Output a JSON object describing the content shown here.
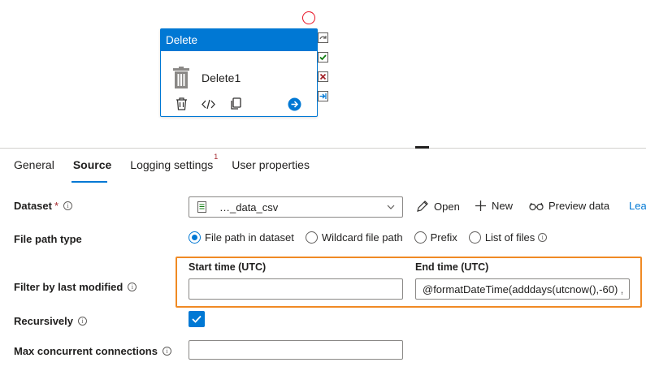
{
  "activity": {
    "header": "Delete",
    "name": "Delete1"
  },
  "tabs": [
    {
      "label": "General"
    },
    {
      "label": "Source"
    },
    {
      "label": "Logging settings",
      "badge": "1"
    },
    {
      "label": "User properties"
    }
  ],
  "form": {
    "dataset": {
      "label": "Dataset",
      "required": "*",
      "value": "…_data_csv",
      "actions": {
        "open": "Open",
        "new": "New",
        "preview": "Preview data",
        "learn": "Lea"
      }
    },
    "file_path_type": {
      "label": "File path type",
      "options": [
        "File path in dataset",
        "Wildcard file path",
        "Prefix",
        "List of files"
      ],
      "selected": "File path in dataset"
    },
    "filter": {
      "label": "Filter by last modified",
      "start_label": "Start time (UTC)",
      "start_value": "",
      "end_label": "End time (UTC)",
      "end_value": "@formatDateTime(adddays(utcnow(),-60) ,'"
    },
    "recursively": {
      "label": "Recursively",
      "checked": true
    },
    "max_connections": {
      "label": "Max concurrent connections",
      "value": ""
    }
  },
  "colors": {
    "accent": "#0078d4",
    "highlight": "#f08a24",
    "error": "#e81123",
    "success": "#107c10"
  }
}
